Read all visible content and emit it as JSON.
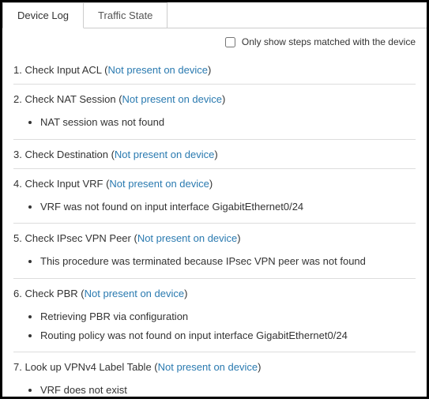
{
  "tabs": [
    {
      "label": "Device Log",
      "active": true
    },
    {
      "label": "Traffic State",
      "active": false
    }
  ],
  "filter_label": "Only show steps matched with the device",
  "not_present_text": "Not present on device",
  "steps": [
    {
      "num": "1",
      "title": "Check Input ACL",
      "details": []
    },
    {
      "num": "2",
      "title": "Check NAT Session",
      "details": [
        "NAT session was not found"
      ]
    },
    {
      "num": "3",
      "title": "Check Destination",
      "details": []
    },
    {
      "num": "4",
      "title": "Check Input VRF",
      "details": [
        "VRF was not found on input interface GigabitEthernet0/24"
      ]
    },
    {
      "num": "5",
      "title": "Check IPsec VPN Peer",
      "details": [
        "This procedure was terminated because IPsec VPN peer was not found"
      ]
    },
    {
      "num": "6",
      "title": "Check PBR",
      "details": [
        "Retrieving PBR via configuration",
        "Routing policy was not found on input interface GigabitEthernet0/24"
      ]
    },
    {
      "num": "7",
      "title": "Look up VPNv4 Label Table",
      "details": [
        "VRF does not exist"
      ]
    }
  ]
}
